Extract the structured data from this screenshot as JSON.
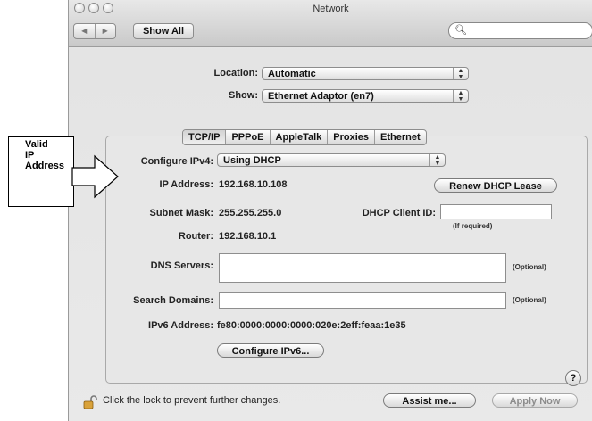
{
  "window": {
    "title": "Network"
  },
  "toolbar": {
    "back_label": "◀",
    "forward_label": "▶",
    "show_all_label": "Show All",
    "search_placeholder": ""
  },
  "location": {
    "label": "Location:",
    "value": "Automatic"
  },
  "show": {
    "label": "Show:",
    "value": "Ethernet Adaptor (en7)"
  },
  "tabs": [
    {
      "label": "TCP/IP",
      "selected": true
    },
    {
      "label": "PPPoE",
      "selected": false
    },
    {
      "label": "AppleTalk",
      "selected": false
    },
    {
      "label": "Proxies",
      "selected": false
    },
    {
      "label": "Ethernet",
      "selected": false
    }
  ],
  "tcpip": {
    "configure_label": "Configure IPv4:",
    "configure_value": "Using DHCP",
    "ip_label": "IP Address:",
    "ip_value": "192.168.10.108",
    "renew_label": "Renew DHCP Lease",
    "subnet_label": "Subnet Mask:",
    "subnet_value": "255.255.255.0",
    "client_id_label": "DHCP Client ID:",
    "client_id_value": "",
    "client_id_hint": "(If required)",
    "router_label": "Router:",
    "router_value": "192.168.10.1",
    "dns_label": "DNS Servers:",
    "dns_value": "",
    "dns_hint": "(Optional)",
    "search_label": "Search Domains:",
    "search_value": "",
    "search_hint": "(Optional)",
    "ipv6_label": "IPv6 Address:",
    "ipv6_value": "fe80:0000:0000:0000:020e:2eff:feaa:1e35",
    "configure_ipv6_label": "Configure IPv6...",
    "help_label": "?"
  },
  "footer": {
    "lock_text": "Click the lock to prevent further changes.",
    "assist_label": "Assist me...",
    "apply_label": "Apply Now"
  },
  "callout": {
    "line1": "Valid",
    "line2": "IP",
    "line3": "Address"
  }
}
